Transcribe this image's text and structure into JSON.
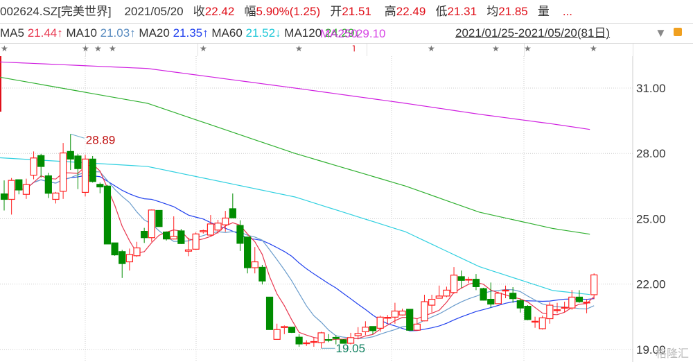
{
  "header": {
    "code": "002624.SZ[完美世界]",
    "date": "2021/05/20",
    "close_label": "收",
    "close": "22.42",
    "change_label": "幅",
    "change": "5.90%(1.25)",
    "open_label": "开",
    "open": "21.51",
    "high_label": "高",
    "high": "22.49",
    "low_label": "低",
    "low": "21.31",
    "avg_label": "均",
    "avg": "21.85",
    "vol_label": "量",
    "more": "..."
  },
  "ma_bar": {
    "ma5_label": "MA5",
    "ma5": "21.44↑",
    "ma10_label": "MA10",
    "ma10": "21.03↑",
    "ma20_label": "MA20",
    "ma20": "21.35↑",
    "ma60_label": "MA60",
    "ma60": "21.52↓",
    "ma120_label": "MA120",
    "ma120": "24.29↓",
    "ma250_label": "MA250",
    "ma250": "29.10",
    "range": "2021/01/25-2021/05/20(81日)",
    "dropdown_icon": "triangle-down",
    "lock_icon": "lock"
  },
  "watermark": "格隆汇",
  "colors": {
    "up": "#ff2020",
    "down": "#008c00",
    "ma5": "#e8364e",
    "ma10": "#6a9ccc",
    "ma20": "#2040ee",
    "ma60": "#30d0e0",
    "ma120": "#30b030",
    "ma250": "#d020e0"
  },
  "chart_data": {
    "type": "candlestick",
    "ylim": [
      18.8,
      33.5
    ],
    "yticks": [
      "31.00",
      "28.00",
      "25.00",
      "22.00",
      "19.00"
    ],
    "high_marker": "28.89",
    "low_marker": "19.05",
    "ohlc": [
      [
        26.14,
        26.76,
        25.38,
        25.89
      ],
      [
        25.89,
        26.87,
        25.19,
        26.76
      ],
      [
        26.79,
        26.79,
        26.12,
        26.32
      ],
      [
        26.12,
        26.84,
        25.91,
        26.57
      ],
      [
        27.0,
        28.09,
        26.81,
        27.79
      ],
      [
        27.9,
        27.98,
        26.89,
        27.4
      ],
      [
        26.97,
        27.11,
        25.95,
        26.17
      ],
      [
        25.89,
        26.23,
        25.7,
        26.18
      ],
      [
        26.26,
        28.48,
        25.91,
        28.02
      ],
      [
        28.09,
        28.89,
        27.24,
        27.74
      ],
      [
        27.88,
        27.98,
        26.36,
        27.3
      ],
      [
        26.21,
        27.93,
        26.02,
        27.74
      ],
      [
        27.74,
        27.88,
        26.66,
        26.71
      ],
      [
        26.58,
        26.66,
        26.17,
        26.46
      ],
      [
        26.5,
        26.55,
        23.84,
        23.84
      ],
      [
        23.89,
        23.89,
        23.3,
        23.34
      ],
      [
        23.49,
        23.57,
        22.28,
        22.94
      ],
      [
        23.02,
        23.63,
        22.62,
        23.36
      ],
      [
        23.3,
        23.94,
        23.25,
        23.66
      ],
      [
        24.42,
        24.58,
        23.89,
        24.13
      ],
      [
        24.13,
        25.43,
        23.94,
        25.4
      ],
      [
        25.38,
        25.38,
        24.64,
        24.64
      ],
      [
        24.39,
        24.42,
        24.0,
        24.07
      ],
      [
        24.07,
        25.11,
        24.05,
        24.19
      ],
      [
        24.44,
        24.53,
        23.84,
        23.86
      ],
      [
        23.51,
        24.13,
        23.28,
        23.57
      ],
      [
        23.6,
        24.37,
        23.57,
        24.3
      ],
      [
        24.4,
        24.5,
        24.32,
        24.45
      ],
      [
        24.25,
        25.17,
        24.21,
        24.76
      ],
      [
        24.48,
        24.95,
        24.32,
        24.8
      ],
      [
        24.72,
        25.36,
        24.4,
        25.03
      ],
      [
        25.46,
        26.16,
        25.04,
        25.04
      ],
      [
        24.69,
        24.93,
        23.52,
        23.87
      ],
      [
        24.16,
        24.16,
        22.49,
        22.75
      ],
      [
        22.75,
        23.7,
        22.49,
        23.02
      ],
      [
        22.77,
        22.88,
        21.98,
        22.14
      ],
      [
        21.4,
        21.4,
        19.91,
        19.91
      ],
      [
        19.46,
        20.18,
        19.44,
        19.91
      ],
      [
        20.0,
        20.1,
        19.7,
        20.05
      ],
      [
        20.02,
        20.02,
        19.75,
        19.78
      ],
      [
        19.56,
        19.7,
        19.12,
        19.25
      ],
      [
        19.27,
        19.42,
        19.16,
        19.3
      ],
      [
        19.33,
        19.54,
        19.12,
        19.36
      ],
      [
        19.31,
        19.81,
        19.05,
        19.76
      ],
      [
        19.45,
        19.7,
        19.33,
        19.43
      ],
      [
        19.55,
        19.65,
        19.23,
        19.5
      ],
      [
        19.44,
        19.47,
        19.28,
        19.28
      ],
      [
        19.28,
        19.76,
        19.23,
        19.54
      ],
      [
        19.63,
        20.02,
        19.46,
        19.73
      ],
      [
        19.81,
        20.29,
        19.65,
        20.02
      ],
      [
        20.05,
        20.05,
        19.7,
        19.86
      ],
      [
        19.97,
        20.55,
        19.81,
        20.48
      ],
      [
        20.44,
        20.58,
        20.18,
        20.47
      ],
      [
        20.48,
        21.14,
        20.18,
        20.76
      ],
      [
        20.58,
        20.87,
        20.55,
        20.76
      ],
      [
        20.84,
        20.84,
        19.86,
        19.88
      ],
      [
        19.88,
        20.39,
        19.86,
        20.16
      ],
      [
        20.31,
        21.51,
        20.29,
        21.19
      ],
      [
        21.03,
        21.51,
        20.69,
        21.3
      ],
      [
        21.35,
        21.93,
        21.35,
        21.45
      ],
      [
        21.45,
        21.88,
        21.4,
        21.72
      ],
      [
        21.61,
        22.78,
        21.56,
        22.41
      ],
      [
        22.34,
        22.62,
        21.83,
        22.17
      ],
      [
        22.18,
        22.33,
        22.04,
        22.22
      ],
      [
        22.22,
        22.46,
        21.72,
        21.88
      ],
      [
        21.79,
        21.83,
        21.24,
        21.26
      ],
      [
        21.3,
        22.07,
        20.92,
        21.08
      ],
      [
        21.1,
        21.65,
        21.08,
        21.58
      ],
      [
        21.7,
        21.93,
        21.35,
        21.72
      ],
      [
        21.58,
        21.86,
        21.14,
        21.33
      ],
      [
        21.24,
        21.33,
        20.69,
        20.9
      ],
      [
        20.98,
        21.03,
        20.34,
        20.37
      ],
      [
        20.26,
        20.5,
        19.99,
        20.29
      ],
      [
        19.95,
        20.55,
        19.91,
        20.45
      ],
      [
        20.41,
        21.16,
        20.18,
        21.03
      ],
      [
        20.8,
        21.14,
        20.66,
        20.82
      ],
      [
        20.9,
        21.19,
        20.71,
        20.93
      ],
      [
        20.9,
        21.72,
        20.82,
        21.4
      ],
      [
        21.4,
        21.72,
        21.14,
        21.19
      ],
      [
        21.14,
        21.3,
        20.66,
        21.17
      ],
      [
        21.51,
        22.49,
        21.31,
        22.42
      ]
    ],
    "ma_long": {
      "ma60": [
        [
          0,
          27.8
        ],
        [
          20,
          27.4
        ],
        [
          40,
          26.0
        ],
        [
          55,
          24.4
        ],
        [
          65,
          22.8
        ],
        [
          75,
          21.7
        ],
        [
          80,
          21.52
        ]
      ],
      "ma120": [
        [
          0,
          31.5
        ],
        [
          20,
          30.3
        ],
        [
          40,
          28.0
        ],
        [
          55,
          26.5
        ],
        [
          65,
          25.3
        ],
        [
          75,
          24.55
        ],
        [
          80,
          24.29
        ]
      ],
      "ma250": [
        [
          0,
          32.2
        ],
        [
          20,
          31.9
        ],
        [
          40,
          31.0
        ],
        [
          55,
          30.3
        ],
        [
          65,
          29.8
        ],
        [
          75,
          29.35
        ],
        [
          80,
          29.1
        ]
      ]
    }
  }
}
